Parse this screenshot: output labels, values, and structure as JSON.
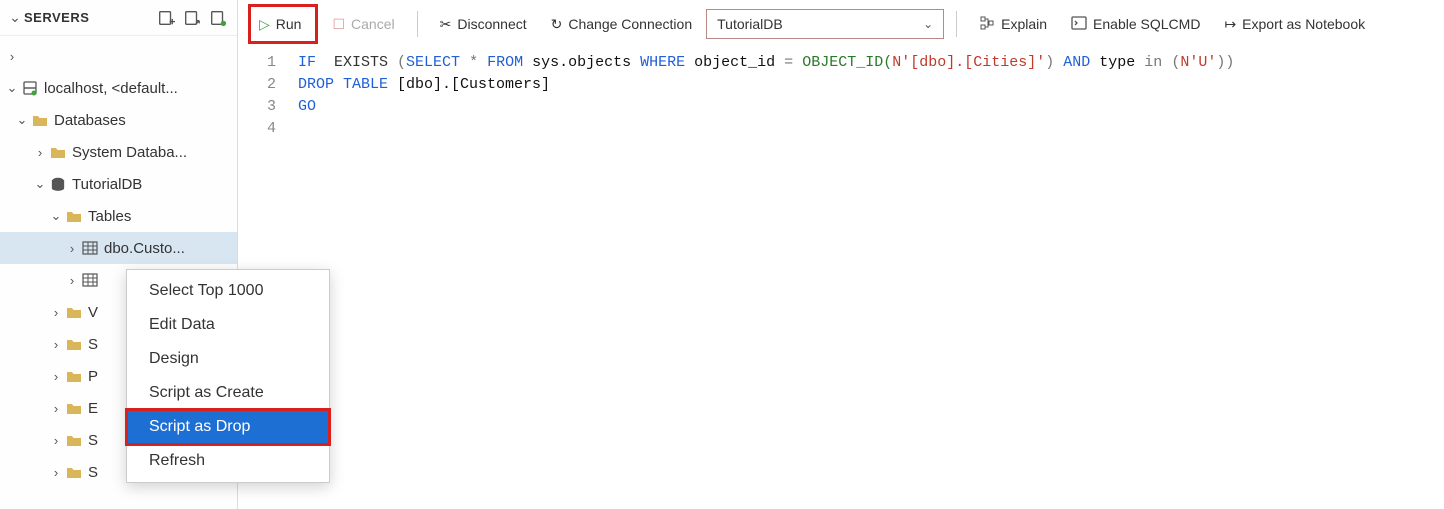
{
  "sidebar": {
    "title": "SERVERS",
    "nodes": {
      "server": "localhost, <default...",
      "databases": "Databases",
      "system_db": "System Databa...",
      "tutorialdb": "TutorialDB",
      "tables": "Tables",
      "tbl0": "dbo.Custo...",
      "folder_v": "V",
      "folder_s1": "S",
      "folder_p": "P",
      "folder_e": "E",
      "folder_s2": "S",
      "folder_s3": "S"
    }
  },
  "toolbar": {
    "run": "Run",
    "cancel": "Cancel",
    "disconnect": "Disconnect",
    "change_conn": "Change Connection",
    "db_selected": "TutorialDB",
    "explain": "Explain",
    "enable_sqlcmd": "Enable SQLCMD",
    "export_nb": "Export as Notebook"
  },
  "editor": {
    "lines": [
      "1",
      "2",
      "3",
      "4"
    ],
    "sql": {
      "l1": {
        "a": "IF",
        "b": "  EXISTS ",
        "c": "(",
        "d": "SELECT",
        "e": " * ",
        "f": "FROM",
        "g": " sys.objects ",
        "h": "WHERE",
        "i": " object_id ",
        "eq": "=",
        "j": " OBJECT_ID(",
        "k": "N'[dbo].[Cities]'",
        "l": ") ",
        "m": "AND",
        "n": " type ",
        "o": "in",
        "p": " (",
        "q": "N'U'",
        "r": "))"
      },
      "l2": {
        "a": "DROP",
        "b": " TABLE ",
        "c": "[dbo].[Customers]"
      },
      "l3": {
        "a": "GO"
      }
    }
  },
  "context_menu": {
    "items": [
      "Select Top 1000",
      "Edit Data",
      "Design",
      "Script as Create",
      "Script as Drop",
      "Refresh"
    ]
  }
}
